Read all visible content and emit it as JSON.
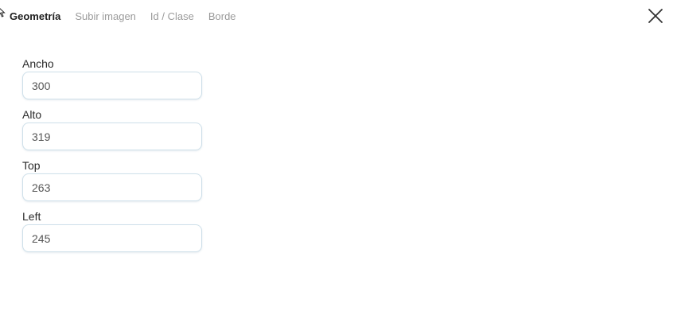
{
  "tabs": [
    {
      "label": "Geometría",
      "active": true
    },
    {
      "label": "Subir imagen",
      "active": false
    },
    {
      "label": "Id / Clase",
      "active": false
    },
    {
      "label": "Borde",
      "active": false
    }
  ],
  "close_icon": "close-icon",
  "fields": [
    {
      "label": "Ancho",
      "value": "300"
    },
    {
      "label": "Alto",
      "value": "319"
    },
    {
      "label": "Top",
      "value": "263"
    },
    {
      "label": "Left",
      "value": "245"
    }
  ],
  "colors": {
    "active_tab": "#1f1f1f",
    "inactive_tab": "#9b9b9b",
    "input_border": "#cfe0ea"
  }
}
